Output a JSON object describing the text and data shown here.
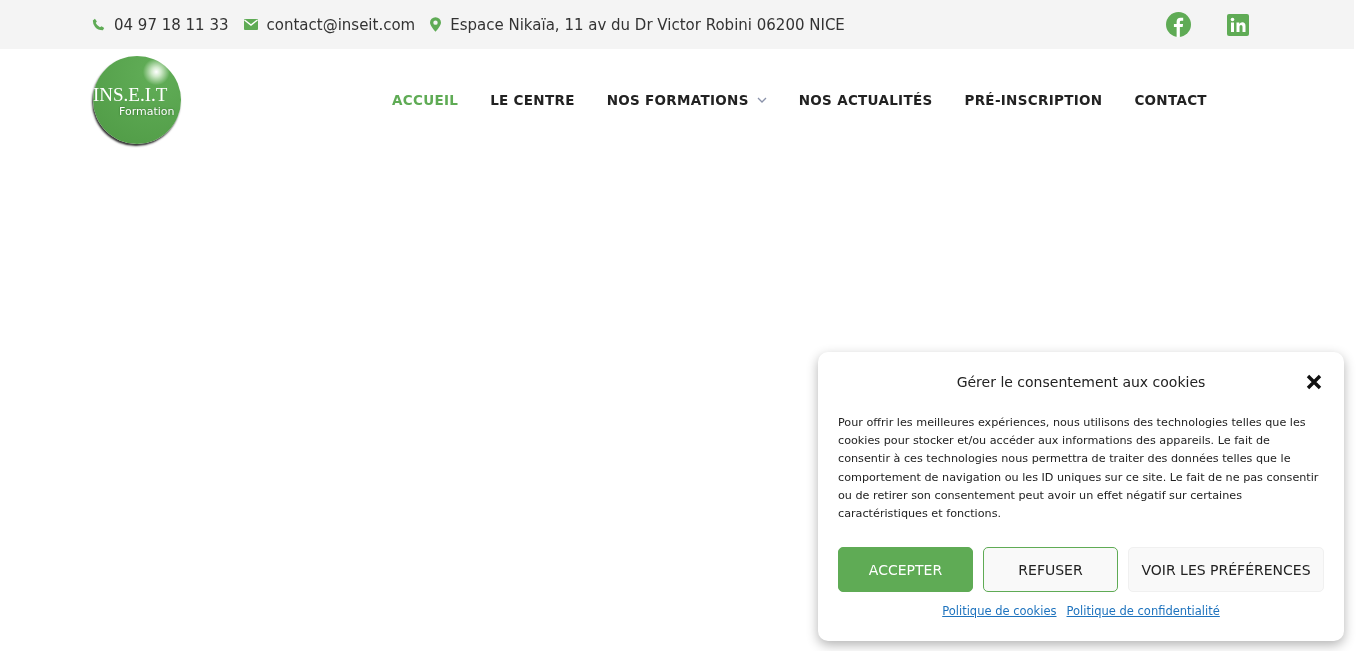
{
  "topbar": {
    "phone": "04 97 18 11 33",
    "email": "contact@inseit.com",
    "address": "Espace Nikaïa, 11 av du Dr Victor Robini 06200 NICE"
  },
  "logo": {
    "title": "INS.E.I.T",
    "subtitle": "Formation"
  },
  "nav": [
    {
      "label": "ACCUEIL",
      "selected": true,
      "dropdown": false
    },
    {
      "label": "LE CENTRE",
      "selected": false,
      "dropdown": false
    },
    {
      "label": "NOS FORMATIONS",
      "selected": false,
      "dropdown": true
    },
    {
      "label": "NOS ACTUALITÉS",
      "selected": false,
      "dropdown": false
    },
    {
      "label": "PRÉ-INSCRIPTION",
      "selected": false,
      "dropdown": false
    },
    {
      "label": "CONTACT",
      "selected": false,
      "dropdown": false
    }
  ],
  "cookie_dialog": {
    "title": "Gérer le consentement aux cookies",
    "text": "Pour offrir les meilleures expériences, nous utilisons des technologies telles que les cookies pour stocker et/ou accéder aux informations des appareils. Le fait de consentir à ces technologies nous permettra de traiter des données telles que le comportement de navigation ou les ID uniques sur ce site. Le fait de ne pas consentir ou de retirer son consentement peut avoir un effet négatif sur certaines caractéristiques et fonctions.",
    "buttons": [
      {
        "label": "ACCEPTER",
        "kind": "primary"
      },
      {
        "label": "REFUSER",
        "kind": "outline"
      },
      {
        "label": "VOIR LES PRÉFÉRENCES",
        "kind": "plain"
      }
    ],
    "links": [
      "Politique de cookies",
      "Politique de confidentialité"
    ]
  }
}
